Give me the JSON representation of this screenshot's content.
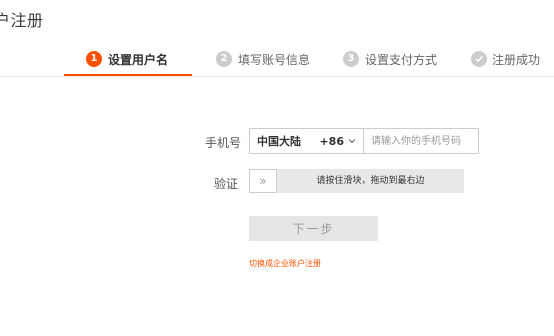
{
  "page": {
    "title": "户注册"
  },
  "steps": [
    {
      "num": "1",
      "label": "设置用户名",
      "active": true
    },
    {
      "num": "2",
      "label": "填写账号信息",
      "active": false
    },
    {
      "num": "3",
      "label": "设置支付方式",
      "active": false
    },
    {
      "num": "",
      "label": "注册成功",
      "active": false,
      "icon": "check-circle-icon"
    }
  ],
  "form": {
    "phone_label": "手机号",
    "region_name": "中国大陆",
    "region_code": "+86",
    "phone_placeholder": "请输入你的手机号码",
    "verify_label": "验证",
    "slider_handle": "»",
    "slider_text": "请按住滑块，拖动到最右边",
    "next_label": "下一步",
    "switch_link": "切换成企业账户注册"
  },
  "colors": {
    "accent": "#ff5000",
    "inactive_step": "#cccccc",
    "button_disabled_bg": "#e6e6e6",
    "slider_bg": "#e8e8e8"
  }
}
